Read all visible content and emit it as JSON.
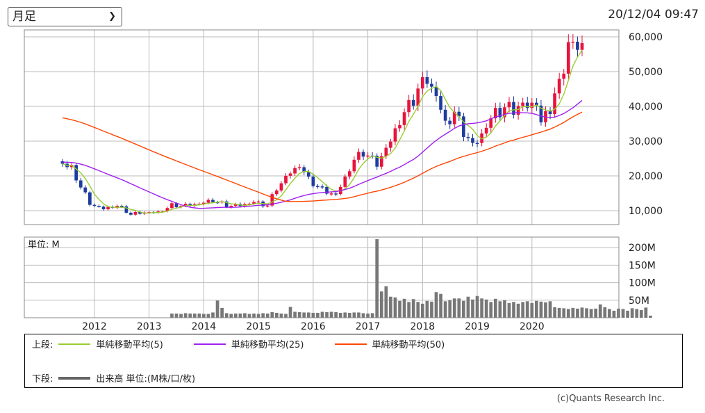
{
  "header": {
    "period_select": {
      "selected": "月足"
    },
    "timestamp": "20/12/04 09:47"
  },
  "volume_unit_label": "単位: M",
  "legend": {
    "upper_label": "上段:",
    "lower_label": "下段:",
    "items": [
      {
        "label": "単純移動平均(5)",
        "color": "#9acd32"
      },
      {
        "label": "単純移動平均(25)",
        "color": "#a020f0"
      },
      {
        "label": "単純移動平均(50)",
        "color": "#ff4500"
      }
    ],
    "volume_item": {
      "label": "出来高 単位:(M株/口/枚)",
      "color": "#666666"
    }
  },
  "copyright": "(c)Quants Research Inc.",
  "colors": {
    "up": "#e8143c",
    "down": "#1e3ca0",
    "volume": "#777777",
    "grid": "#bbbbbb"
  },
  "chart_data": [
    {
      "type": "candlestick",
      "ylim": [
        6000,
        62000
      ],
      "ytick_values": [
        10000,
        20000,
        30000,
        40000,
        50000,
        60000
      ],
      "ytick_labels": [
        "10,000",
        "20,000",
        "30,000",
        "40,000",
        "50,000",
        "60,000"
      ],
      "xtick_labels": [
        "2012",
        "2013",
        "2014",
        "2015",
        "2016",
        "2017",
        "2018",
        "2019",
        "2020"
      ],
      "x_start": "2011-06",
      "x_end": "2020-12",
      "close_anchors": [
        [
          "2011-06",
          23500
        ],
        [
          "2011-08",
          22000
        ],
        [
          "2011-10",
          17000
        ],
        [
          "2011-12",
          12000
        ],
        [
          "2012-03",
          10500
        ],
        [
          "2012-06",
          11500
        ],
        [
          "2012-09",
          9000
        ],
        [
          "2012-12",
          9500
        ],
        [
          "2013-03",
          9500
        ],
        [
          "2013-06",
          11500
        ],
        [
          "2013-09",
          11500
        ],
        [
          "2013-12",
          12000
        ],
        [
          "2014-03",
          13000
        ],
        [
          "2014-06",
          11500
        ],
        [
          "2014-09",
          11500
        ],
        [
          "2014-12",
          12500
        ],
        [
          "2015-03",
          11500
        ],
        [
          "2015-05",
          16500
        ],
        [
          "2015-08",
          21000
        ],
        [
          "2015-10",
          23000
        ],
        [
          "2015-12",
          19000
        ],
        [
          "2016-03",
          16000
        ],
        [
          "2016-06",
          14500
        ],
        [
          "2016-08",
          19500
        ],
        [
          "2016-10",
          24500
        ],
        [
          "2016-12",
          27000
        ],
        [
          "2017-03",
          23500
        ],
        [
          "2017-06",
          30000
        ],
        [
          "2017-08",
          36000
        ],
        [
          "2017-10",
          40000
        ],
        [
          "2017-12",
          45000
        ],
        [
          "2018-02",
          48000
        ],
        [
          "2018-04",
          43000
        ],
        [
          "2018-06",
          35000
        ],
        [
          "2018-08",
          38000
        ],
        [
          "2018-10",
          33000
        ],
        [
          "2018-12",
          28500
        ],
        [
          "2019-02",
          32000
        ],
        [
          "2019-05",
          38500
        ],
        [
          "2019-08",
          39500
        ],
        [
          "2019-11",
          40000
        ],
        [
          "2020-02",
          41000
        ],
        [
          "2020-03",
          35000
        ],
        [
          "2020-05",
          40000
        ],
        [
          "2020-07",
          46000
        ],
        [
          "2020-09",
          58000
        ],
        [
          "2020-11",
          57000
        ],
        [
          "2020-12",
          57500
        ]
      ],
      "series": [
        {
          "name": "単純移動平均(5)",
          "period": 5,
          "color": "#9acd32"
        },
        {
          "name": "単純移動平均(25)",
          "period": 25,
          "color": "#a020f0"
        },
        {
          "name": "単純移動平均(50)",
          "period": 50,
          "color": "#ff4500"
        }
      ]
    },
    {
      "type": "bar",
      "ylim": [
        0,
        230
      ],
      "ytick_values": [
        50,
        100,
        150,
        200
      ],
      "ytick_labels": [
        "50M",
        "100M",
        "150M",
        "200M"
      ],
      "x_start": "2013-06",
      "values": [
        12,
        12,
        11,
        13,
        12,
        12,
        12,
        11,
        11,
        15,
        49,
        28,
        13,
        11,
        12,
        12,
        13,
        11,
        12,
        11,
        13,
        12,
        16,
        14,
        12,
        11,
        31,
        17,
        16,
        15,
        15,
        14,
        14,
        17,
        16,
        17,
        16,
        14,
        15,
        14,
        15,
        15,
        13,
        12,
        13,
        224,
        75,
        90,
        60,
        58,
        48,
        54,
        45,
        53,
        45,
        40,
        48,
        46,
        73,
        68,
        47,
        50,
        55,
        55,
        48,
        60,
        52,
        62,
        55,
        52,
        45,
        54,
        47,
        50,
        42,
        45,
        40,
        45,
        47,
        42,
        48,
        46,
        44,
        47,
        30,
        28,
        27,
        25,
        28,
        26,
        29,
        27,
        25,
        26,
        38,
        30,
        25,
        20,
        26,
        25,
        20,
        27,
        25,
        22,
        29,
        6
      ]
    }
  ]
}
